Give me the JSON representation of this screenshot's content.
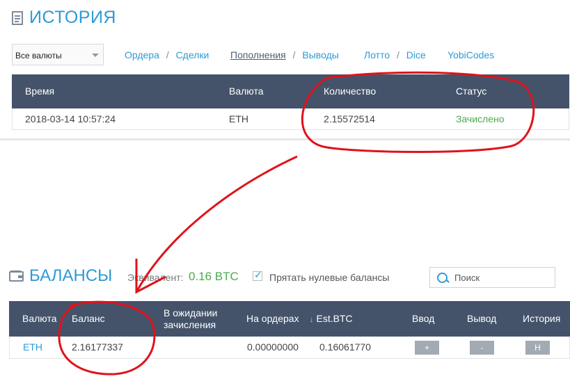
{
  "history": {
    "title": "ИСТОРИЯ",
    "currency_select": "Все валюты",
    "nav": {
      "orders": "Ордера",
      "trades": "Сделки",
      "deposits": "Пополнения",
      "withdrawals": "Выводы",
      "lotto": "Лотто",
      "dice": "Dice",
      "yobicodes": "YobiCodes",
      "separator": "/"
    },
    "columns": [
      "Время",
      "Валюта",
      "Количество",
      "Статус"
    ],
    "rows": [
      {
        "time": "2018-03-14 10:57:24",
        "currency": "ETH",
        "amount": "2.15572514",
        "status": "Зачислено"
      }
    ]
  },
  "balances": {
    "title": "БАЛАНСЫ",
    "equiv_label": "Эквивалент:",
    "equiv_value": "0.16 BTC",
    "hide_zero_label": "Прятать нулевые балансы",
    "hide_zero_checked": true,
    "search_placeholder": "Поиск",
    "columns": {
      "currency": "Валюта",
      "balance": "Баланс",
      "pending_line1": "В ожидании",
      "pending_line2": "зачисления",
      "on_orders": "На ордерах",
      "est_btc": "Est.BTC",
      "deposit": "Ввод",
      "withdraw": "Вывод",
      "history": "История"
    },
    "rows": [
      {
        "currency": "ETH",
        "balance": "2.16177337",
        "pending": "",
        "on_orders": "0.00000000",
        "est_btc": "0.16061770",
        "deposit_btn": "+",
        "withdraw_btn": "-",
        "history_btn": "H"
      }
    ]
  },
  "colors": {
    "accent": "#2e9ad6",
    "header_bg": "#44536a",
    "success": "#4bab4b",
    "annotation": "#e0121b"
  },
  "icons": [
    "history-list-icon",
    "wallet-icon",
    "checkmark-icon",
    "search-icon",
    "chevron-down-icon",
    "sort-down-icon"
  ]
}
